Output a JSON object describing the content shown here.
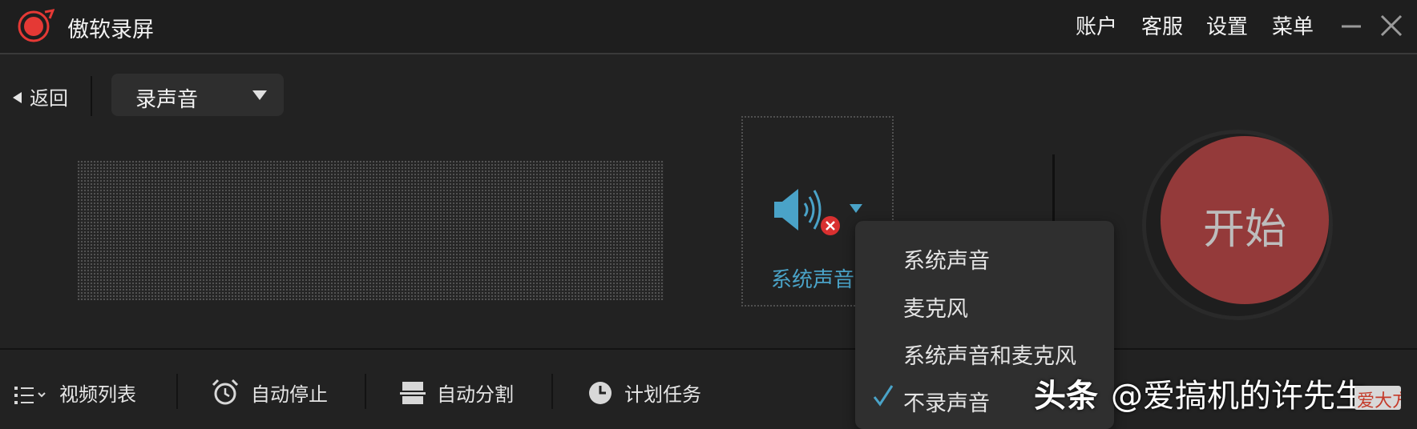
{
  "app": {
    "title": "傲软录屏",
    "logo_icon": "record-logo-icon",
    "accent_color": "#e53935"
  },
  "header": {
    "menu": [
      {
        "label": "账户"
      },
      {
        "label": "客服"
      },
      {
        "label": "设置"
      },
      {
        "label": "菜单"
      }
    ],
    "minimize_icon": "minimize-icon",
    "close_icon": "close-icon"
  },
  "toolbar": {
    "back_label": "返回",
    "mode_select": {
      "value": "录声音"
    }
  },
  "audio_source": {
    "label": "系统声音",
    "icon": "speaker-icon",
    "status_icon": "mute-badge-icon",
    "accent_color": "#4aa3c8"
  },
  "start_button": {
    "label": "开始",
    "color": "#943a3a"
  },
  "audio_menu": {
    "options": [
      {
        "label": "系统声音",
        "selected": false
      },
      {
        "label": "麦克风",
        "selected": false
      },
      {
        "label": "系统声音和麦克风",
        "selected": false
      },
      {
        "label": "不录声音",
        "selected": true
      }
    ],
    "check_icon": "checkmark-icon"
  },
  "bottom_tools": [
    {
      "label": "视频列表",
      "icon": "list-icon"
    },
    {
      "label": "自动停止",
      "icon": "alarm-clock-icon"
    },
    {
      "label": "自动分割",
      "icon": "split-icon"
    },
    {
      "label": "计划任务",
      "icon": "clock-icon"
    }
  ],
  "watermark": {
    "brand": "头条",
    "handle": "@爱搞机的许先生",
    "badge": "爱大方"
  }
}
